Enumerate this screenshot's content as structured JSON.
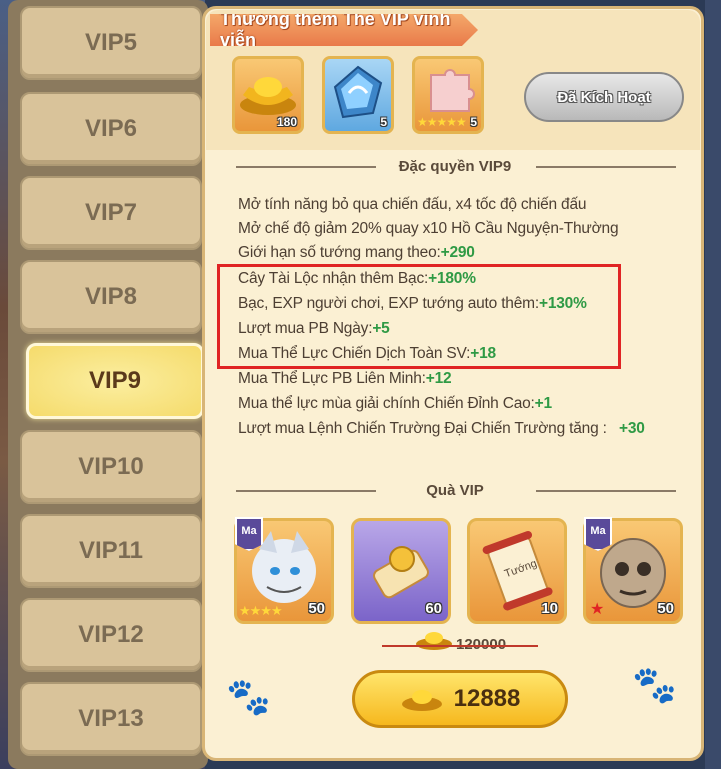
{
  "sidebar": {
    "items": [
      "VIP5",
      "VIP6",
      "VIP7",
      "VIP8",
      "VIP9",
      "VIP10",
      "VIP11",
      "VIP12",
      "VIP13"
    ],
    "active": "VIP9"
  },
  "panel": {
    "title": "Thưởng thêm Thẻ VIP vĩnh viễn",
    "rewards": [
      {
        "icon": "gold-ingot-icon",
        "count": "180"
      },
      {
        "icon": "blue-crystal-icon",
        "count": "5"
      },
      {
        "icon": "puzzle-piece-icon",
        "count": "5"
      }
    ],
    "activated_label": "Đã Kích Hoạt",
    "privileges_header": "Đặc quyền VIP9",
    "privileges": [
      {
        "text": "Mở tính năng bỏ qua chiến đấu, x4 tốc độ chiến đấu",
        "value": ""
      },
      {
        "text": "Mở chế độ giảm 20% quay x10 Hồ Cầu Nguyện-Thường",
        "value": ""
      },
      {
        "text": "Giới hạn số tướng mang theo:",
        "value": "+290"
      },
      {
        "text": "Cây Tài Lộc nhận thêm Bạc:",
        "value": "+180%"
      },
      {
        "text": "Bạc, EXP người chơi, EXP tướng auto thêm:",
        "value": "+130%"
      },
      {
        "text": "Lượt mua PB Ngày:",
        "value": "+5"
      },
      {
        "text": "Mua Thể Lực Chiến Dịch Toàn SV:",
        "value": "+18"
      },
      {
        "text": "Mua Thể Lực PB Liên Minh:",
        "value": "+12"
      },
      {
        "text": "Mua thể lực mùa giải chính Chiến Đỉnh Cao:",
        "value": "+1"
      },
      {
        "text": "Lượt mua Lệnh Chiến Trường Đại Chiến Trường tăng :",
        "value": "+30"
      }
    ],
    "gift_header": "Quà VIP",
    "gifts": [
      {
        "icon": "hero-wolf-icon",
        "tag": "Ma",
        "count": "50"
      },
      {
        "icon": "scroll-coin-icon",
        "tag": "",
        "count": "60"
      },
      {
        "icon": "hero-scroll-icon",
        "tag": "",
        "count": "10",
        "label": "Tướng"
      },
      {
        "icon": "hero-golem-icon",
        "tag": "Ma",
        "count": "50"
      }
    ],
    "old_price": "120000",
    "price": "12888"
  },
  "colors": {
    "accent_green": "#2f9a45",
    "highlight_red": "#e02424",
    "active_tab": "#f5db6b"
  }
}
